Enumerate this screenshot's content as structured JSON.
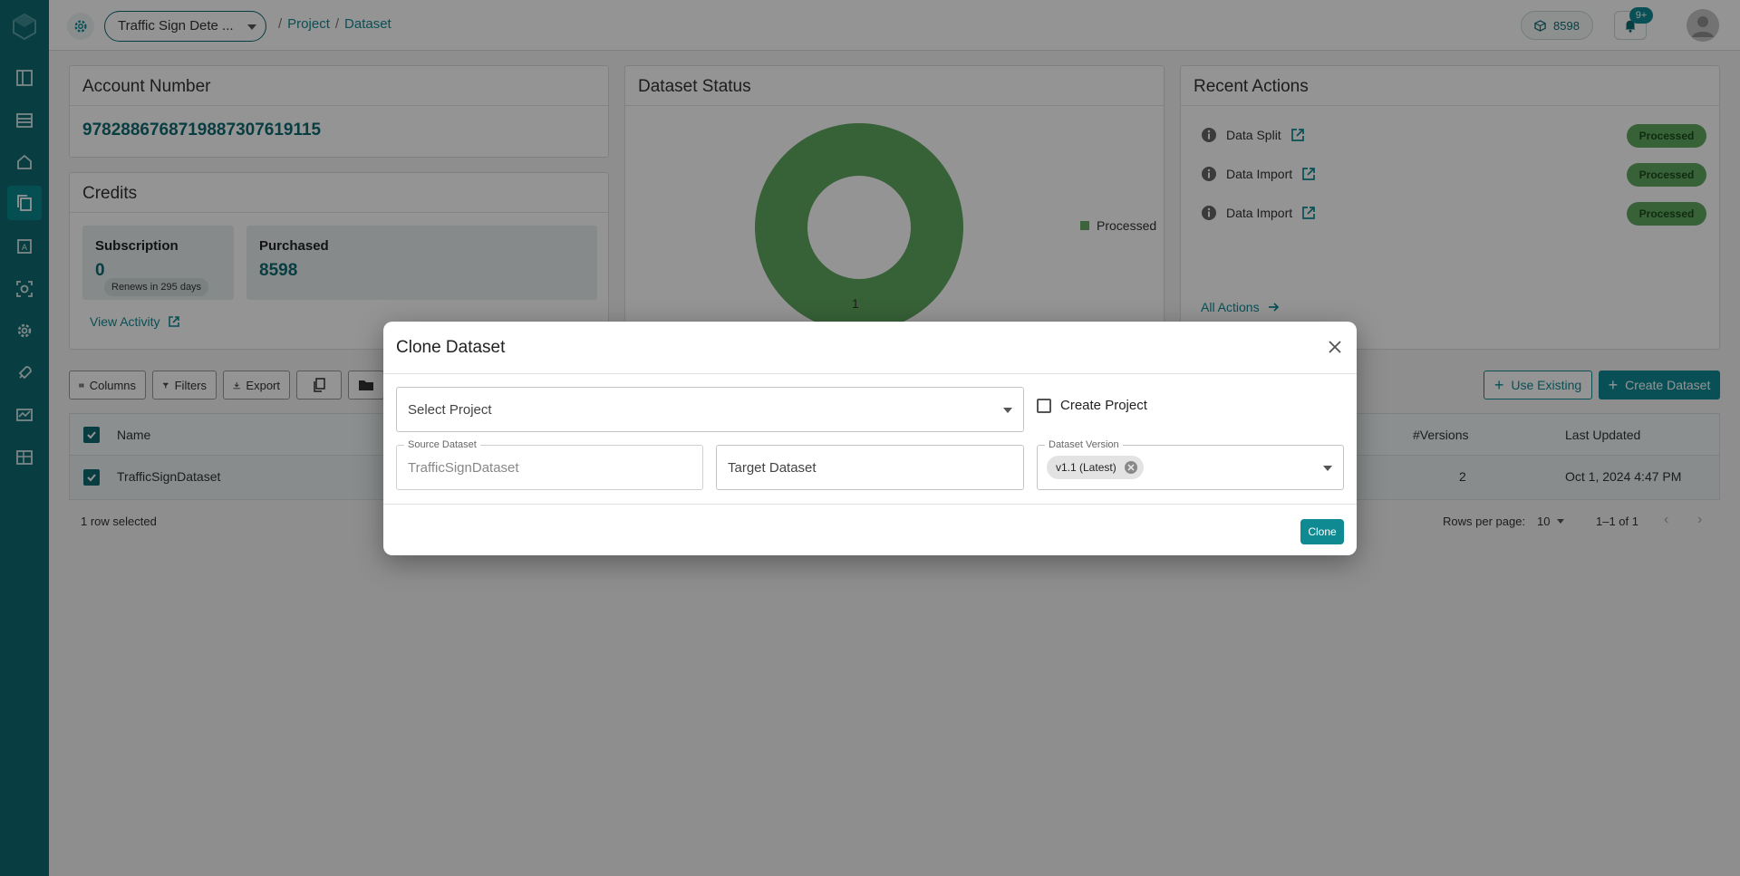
{
  "topbar": {
    "project_name": "Traffic Sign Dete ...",
    "breadcrumb": [
      "Project",
      "Dataset"
    ],
    "credits": "8598",
    "notifications_badge": "9+"
  },
  "account": {
    "title": "Account Number",
    "number": "97828867687198873076191​15"
  },
  "credits_card": {
    "title": "Credits",
    "subscription_label": "Subscription",
    "subscription_value": "0",
    "renews": "Renews in 295 days",
    "purchased_label": "Purchased",
    "purchased_value": "8598",
    "view_activity": "View Activity"
  },
  "dataset_status": {
    "title": "Dataset Status",
    "chart_data": {
      "type": "pie",
      "categories": [
        "Processed"
      ],
      "values": [
        1
      ],
      "legend_position": "right"
    },
    "legend_label": "Processed",
    "slice_label": "1"
  },
  "recent_actions": {
    "title": "Recent Actions",
    "items": [
      {
        "name": "Data Split",
        "status": "Processed"
      },
      {
        "name": "Data Import",
        "status": "Processed"
      },
      {
        "name": "Data Import",
        "status": "Processed"
      }
    ],
    "all_actions": "All Actions"
  },
  "toolbar": {
    "columns": "Columns",
    "filters": "Filters",
    "export": "Export",
    "use_existing": "Use Existing",
    "create_dataset": "Create Dataset"
  },
  "table": {
    "headers": {
      "name": "Name",
      "versions": "#Versions",
      "last_updated": "Last Updated"
    },
    "rows": [
      {
        "name": "TrafficSignDataset",
        "versions": "2",
        "last_updated": "Oct 1, 2024 4:47 PM"
      }
    ],
    "selected_text": "1 row selected",
    "rows_per_page_label": "Rows per page:",
    "rows_per_page": "10",
    "range": "1–1 of 1"
  },
  "modal": {
    "title": "Clone Dataset",
    "select_project_placeholder": "Select Project",
    "create_project_label": "Create Project",
    "source_dataset_label": "Source Dataset",
    "source_dataset_value": "TrafficSignDataset",
    "target_dataset_placeholder": "Target Dataset",
    "dataset_version_label": "Dataset Version",
    "dataset_version_chip": "v1.1 (Latest)",
    "clone_button": "Clone"
  },
  "colors": {
    "sidebar": "#0f6b73",
    "accent": "#0f8a93",
    "processed": "#5fa75f"
  }
}
